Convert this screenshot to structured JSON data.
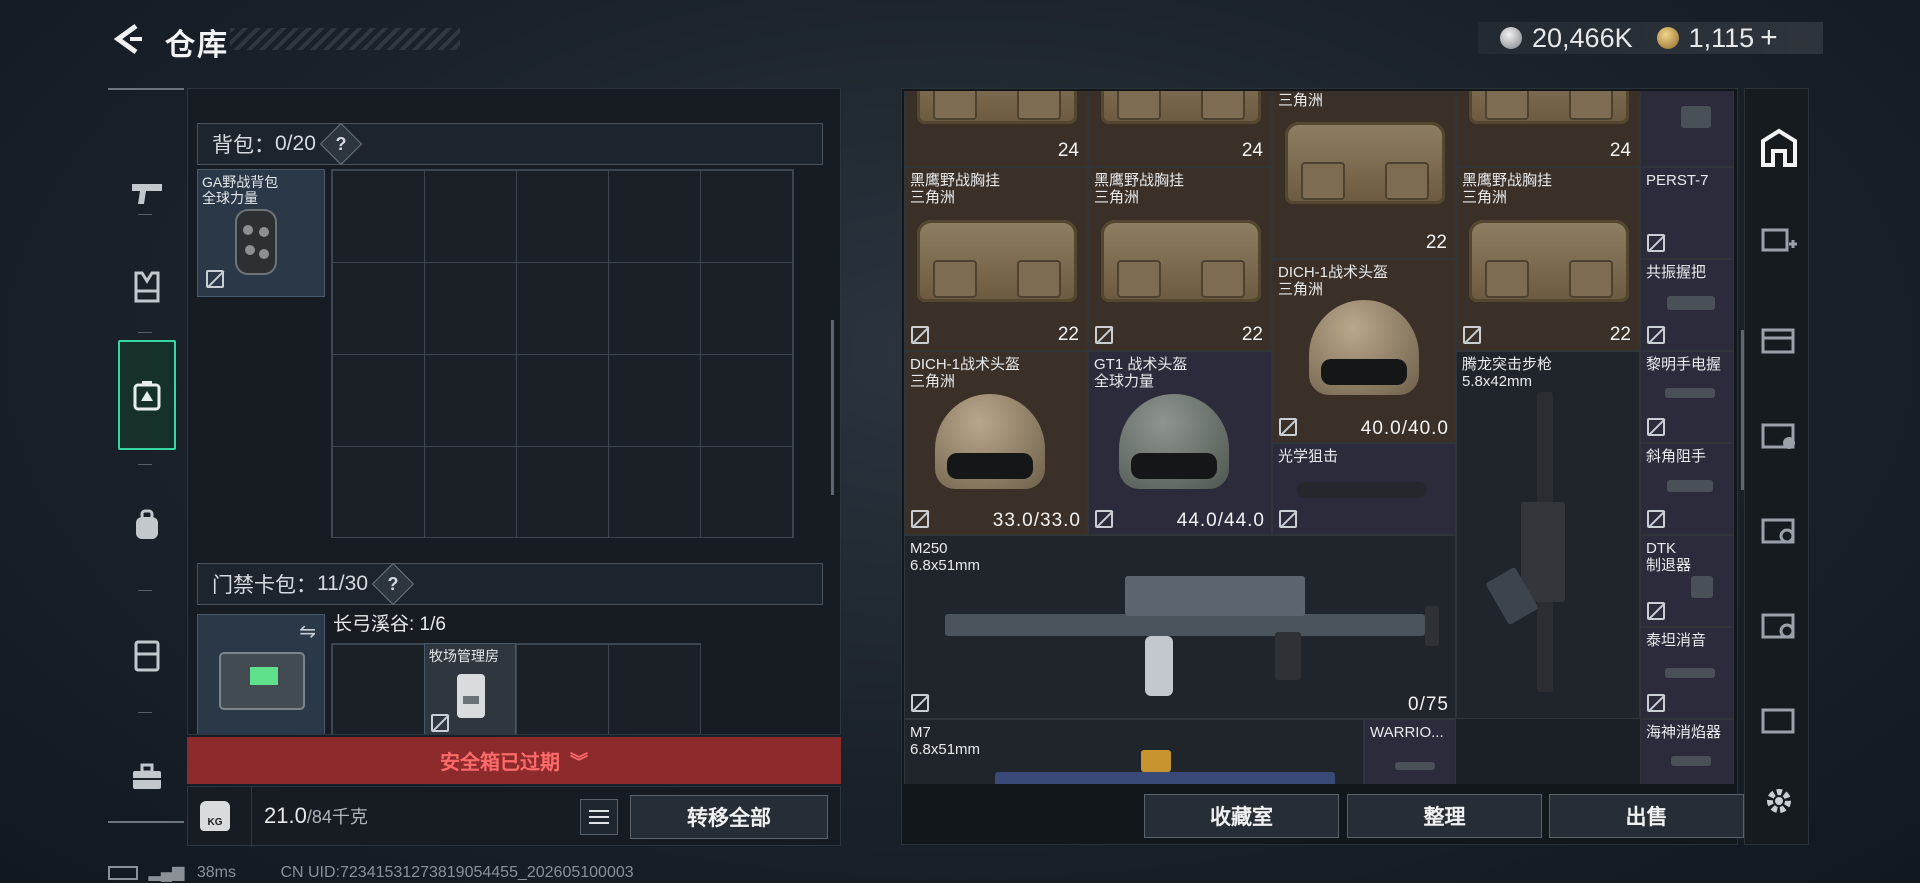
{
  "header": {
    "title": "仓库",
    "silver": "20,466K",
    "gold": "1,115"
  },
  "left_nav": [
    "weapons-tab",
    "armor-tab",
    "safebox-tab",
    "backpack-tab",
    "chest-rig-tab",
    "case-tab"
  ],
  "backpack": {
    "label": "背包：",
    "count": "0/20",
    "help": "?",
    "item": {
      "name_line1": "GA野战背包",
      "name_line2": "全球力量"
    }
  },
  "keycards": {
    "label": "门禁卡包：",
    "count": "11/30",
    "help": "?",
    "map": "长弓溪谷: 1/6",
    "card": "牧场管理房"
  },
  "expired_notice": "安全箱已过期",
  "weight": {
    "current": "21.0",
    "max": "/84千克",
    "icon_text": "KG"
  },
  "buttons": {
    "transfer_all": "转移全部",
    "collection": "收藏室",
    "organize": "整理",
    "sell": "出售"
  },
  "stash": [
    {
      "id": "bag1",
      "name1": "",
      "name2": "",
      "stack": "24"
    },
    {
      "id": "bag2",
      "name1": "",
      "name2": "",
      "stack": "24"
    },
    {
      "id": "bag3",
      "name1": "",
      "name2": "三角洲",
      "stack": "22"
    },
    {
      "id": "bag4",
      "name1": "",
      "name2": "",
      "stack": "24"
    },
    {
      "id": "bag5",
      "name1": "黑鹰野战胸挂",
      "name2": "三角洲",
      "stack": "22"
    },
    {
      "id": "bag6",
      "name1": "黑鹰野战胸挂",
      "name2": "三角洲",
      "stack": "22"
    },
    {
      "id": "bag7",
      "name1": "黑鹰野战胸挂",
      "name2": "三角洲",
      "stack": "22"
    },
    {
      "id": "helm1",
      "name1": "DICH-1战术头盔",
      "name2": "三角洲",
      "durability": "40.0/40.0"
    },
    {
      "id": "helm2",
      "name1": "DICH-1战术头盔",
      "name2": "三角洲",
      "durability": "33.0/33.0"
    },
    {
      "id": "helm3",
      "name1": "GT1 战术头盔",
      "name2": "全球力量",
      "durability": "44.0/44.0"
    },
    {
      "id": "scope",
      "name1": "光学狙击"
    },
    {
      "id": "rifle",
      "name1": "腾龙突击步枪",
      "name2": "5.8x42mm"
    },
    {
      "id": "m250",
      "name1": "M250",
      "name2": "6.8x51mm",
      "ammo": "0/75"
    },
    {
      "id": "m7",
      "name1": "M7",
      "name2": "6.8x51mm"
    },
    {
      "id": "warrior",
      "name1": "WARRIO..."
    },
    {
      "id": "a1",
      "name1": "PERST-7"
    },
    {
      "id": "a2",
      "name1": "共振握把"
    },
    {
      "id": "a3",
      "name1": "黎明手电握"
    },
    {
      "id": "a4",
      "name1": "斜角阻手"
    },
    {
      "id": "a5",
      "name1": "DTK",
      "name2": "制退器"
    },
    {
      "id": "a6",
      "name1": "泰坦消音"
    },
    {
      "id": "a7",
      "name1": "海神消焰器"
    }
  ],
  "right_bar": [
    "base-icon",
    "add-case-icon",
    "case-2-icon",
    "case-4-icon",
    "case-5-icon",
    "case-4b-icon",
    "case-4c-icon",
    "settings-icon"
  ],
  "footer": {
    "ping": "38ms",
    "uid": "CN UID:72341531273819054455_202605100003"
  }
}
